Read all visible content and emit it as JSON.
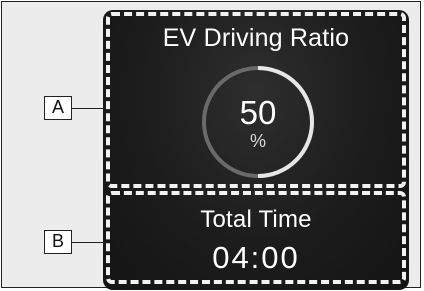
{
  "panel": {
    "section_a": {
      "title": "EV Driving Ratio",
      "value": "50",
      "unit": "%",
      "ratio": 0.5
    },
    "section_b": {
      "title": "Total Time",
      "time": "04:00"
    }
  },
  "callouts": {
    "a": "A",
    "b": "B"
  },
  "colors": {
    "display_bg": "#1c1c1c",
    "text": "#ffffff",
    "gauge_fill": "#e6e6e6",
    "gauge_track": "#6a6a6a"
  }
}
